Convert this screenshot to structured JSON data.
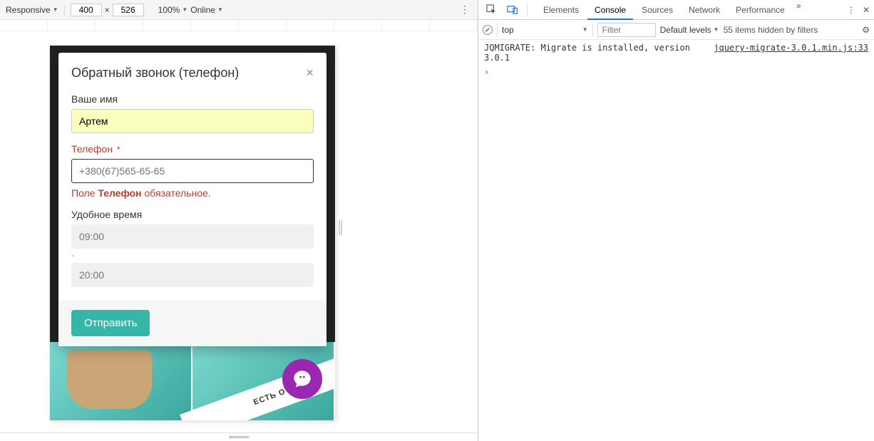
{
  "device_toolbar": {
    "mode": "Responsive",
    "width": "400",
    "height": "526",
    "times": "×",
    "zoom": "100%",
    "network": "Online"
  },
  "modal": {
    "title": "Обратный звонок (телефон)",
    "name_label": "Ваше имя",
    "name_value": "Артем",
    "phone_label": "Телефон",
    "phone_required": "*",
    "phone_placeholder": "+380(67)565-65-65",
    "phone_err_prefix": "Поле ",
    "phone_err_bold": "Телефон",
    "phone_err_suffix": " обязательное.",
    "time_label": "Удобное время",
    "time_from_placeholder": "09:00",
    "time_sep": "-",
    "time_to_placeholder": "20:00",
    "submit": "Отправить"
  },
  "site": {
    "banner_text": "ЕСТЬ ОТКРЫТ"
  },
  "devtools": {
    "tabs": [
      "Elements",
      "Console",
      "Sources",
      "Network",
      "Performance"
    ],
    "active_tab": "Console",
    "more": "»",
    "scope": "top",
    "filter_placeholder": "Filter",
    "levels": "Default levels",
    "hidden_info": "55 items hidden by filters"
  },
  "console": {
    "msg": "JQMIGRATE: Migrate is installed, version 3.0.1",
    "src": "jquery-migrate-3.0.1.min.js:33",
    "prompt": "›"
  }
}
